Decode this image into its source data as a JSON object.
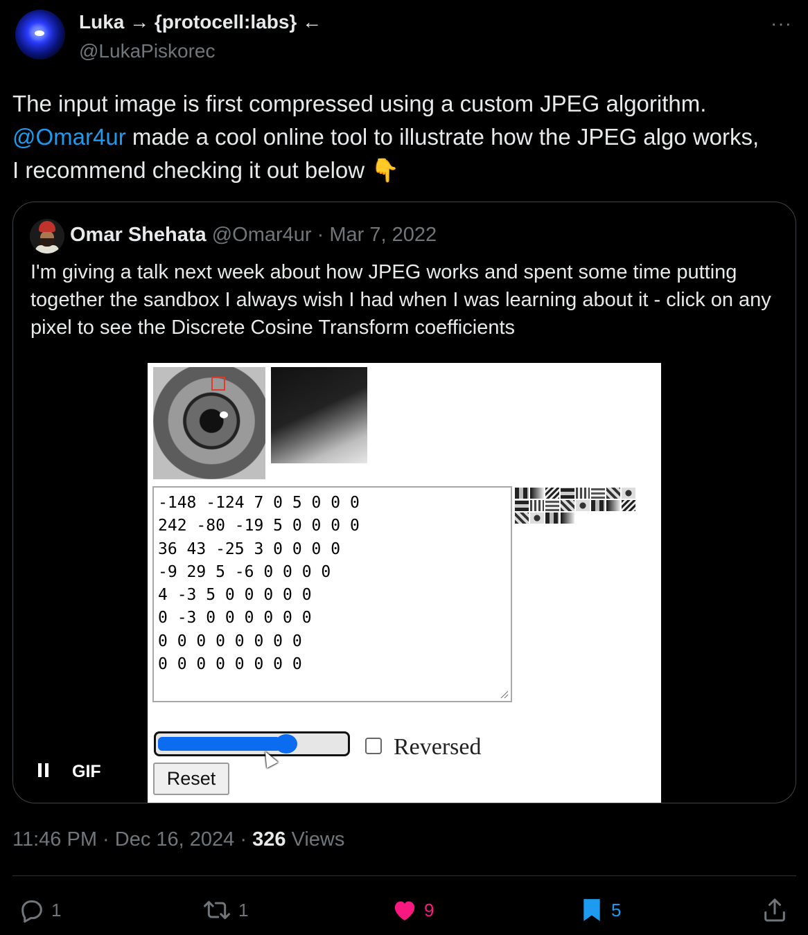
{
  "author": {
    "name": "Luka → {protocell:labs} ←",
    "handle": "@LukaPiskorec"
  },
  "more_label": "···",
  "tweet": {
    "line1": "The input image is first compressed using a custom JPEG algorithm.",
    "mention": "@Omar4ur",
    "line2_rest": " made a cool online tool to illustrate how the JPEG algo works,",
    "line3": "I recommend checking it out below 👇"
  },
  "quote": {
    "name": "Omar Shehata",
    "handle": "@Omar4ur",
    "separator": "·",
    "date": "Mar 7, 2022",
    "text": "I'm giving a talk next week about how JPEG works and spent some time putting together the sandbox I always wish I had when I was learning about it - click on any pixel to see the Discrete Cosine Transform coefficients"
  },
  "media": {
    "coefficients": [
      "-148 -124 7 0 5 0 0 0",
      "242 -80 -19 5 0 0 0 0",
      "36 43 -25 3 0 0 0 0",
      "-9 29 5 -6 0 0 0 0",
      "4 -3 5 0 0 0 0 0",
      "0 -3 0 0 0 0 0 0",
      "0 0 0 0 0 0 0 0",
      "0 0 0 0 0 0 0 0"
    ],
    "slider_value": 0.68,
    "reversed_checked": false,
    "reversed_label": "Reversed",
    "reset_label": "Reset",
    "gif_label": "GIF"
  },
  "meta": {
    "time": "11:46 PM",
    "sep1": " · ",
    "date": "Dec 16, 2024",
    "sep2": " · ",
    "views_count": "326",
    "views_label": " Views"
  },
  "actions": {
    "replies": "1",
    "retweets": "1",
    "likes": "9",
    "bookmarks": "5"
  },
  "colors": {
    "accent": "#1d9bf0",
    "like": "#f91880",
    "muted": "#71767b"
  }
}
